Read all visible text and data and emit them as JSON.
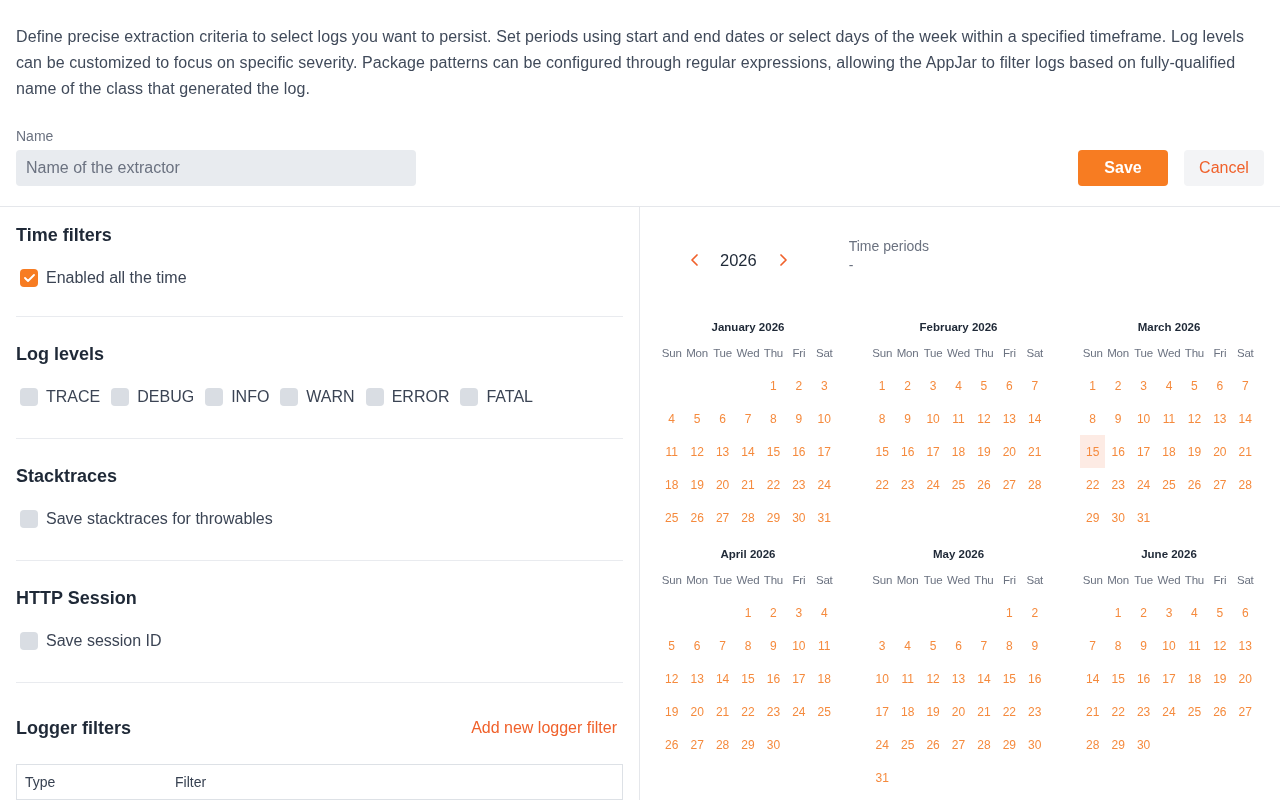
{
  "description": "Define precise extraction criteria to select logs you want to persist. Set periods using start and end dates or select days of the week within a specified timeframe. Log levels can be customized to focus on specific severity. Package patterns can be configured through regular expressions, allowing the AppJar to filter logs based on fully-qualified name of the class that generated the log.",
  "name_field": {
    "label": "Name",
    "placeholder": "Name of the extractor"
  },
  "buttons": [
    {
      "label": "Save",
      "kind": "primary"
    },
    {
      "label": "Cancel",
      "kind": "secondary"
    }
  ],
  "sections": [
    {
      "title": "Time filters",
      "options": [
        {
          "label": "Enabled all the time",
          "checked": true
        }
      ]
    },
    {
      "title": "Log levels",
      "options": [
        {
          "label": "TRACE",
          "checked": false
        },
        {
          "label": "DEBUG",
          "checked": false
        },
        {
          "label": "INFO",
          "checked": false
        },
        {
          "label": "WARN",
          "checked": false
        },
        {
          "label": "ERROR",
          "checked": false
        },
        {
          "label": "FATAL",
          "checked": false
        }
      ]
    },
    {
      "title": "Stacktraces",
      "options": [
        {
          "label": "Save stacktraces for throwables",
          "checked": false
        }
      ]
    },
    {
      "title": "HTTP Session",
      "options": [
        {
          "label": "Save session ID",
          "checked": false
        }
      ]
    }
  ],
  "logger_filters": {
    "title": "Logger filters",
    "add_link": "Add new logger filter",
    "table": {
      "columns": [
        "Type",
        "Filter"
      ]
    }
  },
  "calendar": {
    "year": "2026",
    "time_periods": {
      "label": "Time periods",
      "value": "-"
    },
    "months": [
      {
        "title": "January 2026",
        "weekdays": [
          "Sun",
          "Mon",
          "Tue",
          "Wed",
          "Thu",
          "Fri",
          "Sat"
        ],
        "weeks": [
          [
            {
              "day": "1",
              "today": false
            },
            {
              "day": "2",
              "today": false
            },
            {
              "day": "3",
              "today": false
            }
          ],
          [
            {
              "day": "4",
              "today": false
            },
            {
              "day": "5",
              "today": false
            },
            {
              "day": "6",
              "today": false
            },
            {
              "day": "7",
              "today": false
            },
            {
              "day": "8",
              "today": false
            },
            {
              "day": "9",
              "today": false
            },
            {
              "day": "10",
              "today": false
            }
          ],
          [
            {
              "day": "11",
              "today": false
            },
            {
              "day": "12",
              "today": false
            },
            {
              "day": "13",
              "today": false
            },
            {
              "day": "14",
              "today": false
            },
            {
              "day": "15",
              "today": false
            },
            {
              "day": "16",
              "today": false
            },
            {
              "day": "17",
              "today": false
            }
          ],
          [
            {
              "day": "18",
              "today": false
            },
            {
              "day": "19",
              "today": false
            },
            {
              "day": "20",
              "today": false
            },
            {
              "day": "21",
              "today": false
            },
            {
              "day": "22",
              "today": false
            },
            {
              "day": "23",
              "today": false
            },
            {
              "day": "24",
              "today": false
            }
          ],
          [
            {
              "day": "25",
              "today": false
            },
            {
              "day": "26",
              "today": false
            },
            {
              "day": "27",
              "today": false
            },
            {
              "day": "28",
              "today": false
            },
            {
              "day": "29",
              "today": false
            },
            {
              "day": "30",
              "today": false
            },
            {
              "day": "31",
              "today": false
            }
          ]
        ]
      },
      {
        "title": "February 2026",
        "weekdays": [
          "Sun",
          "Mon",
          "Tue",
          "Wed",
          "Thu",
          "Fri",
          "Sat"
        ],
        "weeks": [
          [
            {
              "day": "1",
              "today": false
            },
            {
              "day": "2",
              "today": false
            },
            {
              "day": "3",
              "today": false
            },
            {
              "day": "4",
              "today": false
            },
            {
              "day": "5",
              "today": false
            },
            {
              "day": "6",
              "today": false
            },
            {
              "day": "7",
              "today": false
            }
          ],
          [
            {
              "day": "8",
              "today": false
            },
            {
              "day": "9",
              "today": false
            },
            {
              "day": "10",
              "today": false
            },
            {
              "day": "11",
              "today": false
            },
            {
              "day": "12",
              "today": false
            },
            {
              "day": "13",
              "today": false
            },
            {
              "day": "14",
              "today": false
            }
          ],
          [
            {
              "day": "15",
              "today": false
            },
            {
              "day": "16",
              "today": false
            },
            {
              "day": "17",
              "today": false
            },
            {
              "day": "18",
              "today": false
            },
            {
              "day": "19",
              "today": false
            },
            {
              "day": "20",
              "today": false
            },
            {
              "day": "21",
              "today": false
            }
          ],
          [
            {
              "day": "22",
              "today": false
            },
            {
              "day": "23",
              "today": false
            },
            {
              "day": "24",
              "today": false
            },
            {
              "day": "25",
              "today": false
            },
            {
              "day": "26",
              "today": false
            },
            {
              "day": "27",
              "today": false
            },
            {
              "day": "28",
              "today": false
            }
          ]
        ]
      },
      {
        "title": "March 2026",
        "weekdays": [
          "Sun",
          "Mon",
          "Tue",
          "Wed",
          "Thu",
          "Fri",
          "Sat"
        ],
        "weeks": [
          [
            {
              "day": "1",
              "today": false
            },
            {
              "day": "2",
              "today": false
            },
            {
              "day": "3",
              "today": false
            },
            {
              "day": "4",
              "today": false
            },
            {
              "day": "5",
              "today": false
            },
            {
              "day": "6",
              "today": false
            },
            {
              "day": "7",
              "today": false
            }
          ],
          [
            {
              "day": "8",
              "today": false
            },
            {
              "day": "9",
              "today": false
            },
            {
              "day": "10",
              "today": false
            },
            {
              "day": "11",
              "today": false
            },
            {
              "day": "12",
              "today": false
            },
            {
              "day": "13",
              "today": false
            },
            {
              "day": "14",
              "today": false
            }
          ],
          [
            {
              "day": "15",
              "today": true
            },
            {
              "day": "16",
              "today": false
            },
            {
              "day": "17",
              "today": false
            },
            {
              "day": "18",
              "today": false
            },
            {
              "day": "19",
              "today": false
            },
            {
              "day": "20",
              "today": false
            },
            {
              "day": "21",
              "today": false
            }
          ],
          [
            {
              "day": "22",
              "today": false
            },
            {
              "day": "23",
              "today": false
            },
            {
              "day": "24",
              "today": false
            },
            {
              "day": "25",
              "today": false
            },
            {
              "day": "26",
              "today": false
            },
            {
              "day": "27",
              "today": false
            },
            {
              "day": "28",
              "today": false
            }
          ],
          [
            {
              "day": "29",
              "today": false
            },
            {
              "day": "30",
              "today": false
            },
            {
              "day": "31",
              "today": false
            }
          ]
        ]
      },
      {
        "title": "April 2026",
        "weekdays": [
          "Sun",
          "Mon",
          "Tue",
          "Wed",
          "Thu",
          "Fri",
          "Sat"
        ],
        "weeks": [
          [
            {
              "day": "1",
              "today": false
            },
            {
              "day": "2",
              "today": false
            },
            {
              "day": "3",
              "today": false
            },
            {
              "day": "4",
              "today": false
            }
          ],
          [
            {
              "day": "5",
              "today": false
            },
            {
              "day": "6",
              "today": false
            },
            {
              "day": "7",
              "today": false
            },
            {
              "day": "8",
              "today": false
            },
            {
              "day": "9",
              "today": false
            },
            {
              "day": "10",
              "today": false
            },
            {
              "day": "11",
              "today": false
            }
          ],
          [
            {
              "day": "12",
              "today": false
            },
            {
              "day": "13",
              "today": false
            },
            {
              "day": "14",
              "today": false
            },
            {
              "day": "15",
              "today": false
            },
            {
              "day": "16",
              "today": false
            },
            {
              "day": "17",
              "today": false
            },
            {
              "day": "18",
              "today": false
            }
          ],
          [
            {
              "day": "19",
              "today": false
            },
            {
              "day": "20",
              "today": false
            },
            {
              "day": "21",
              "today": false
            },
            {
              "day": "22",
              "today": false
            },
            {
              "day": "23",
              "today": false
            },
            {
              "day": "24",
              "today": false
            },
            {
              "day": "25",
              "today": false
            }
          ],
          [
            {
              "day": "26",
              "today": false
            },
            {
              "day": "27",
              "today": false
            },
            {
              "day": "28",
              "today": false
            },
            {
              "day": "29",
              "today": false
            },
            {
              "day": "30",
              "today": false
            }
          ]
        ]
      },
      {
        "title": "May 2026",
        "weekdays": [
          "Sun",
          "Mon",
          "Tue",
          "Wed",
          "Thu",
          "Fri",
          "Sat"
        ],
        "weeks": [
          [
            {
              "day": "1",
              "today": false
            },
            {
              "day": "2",
              "today": false
            }
          ],
          [
            {
              "day": "3",
              "today": false
            },
            {
              "day": "4",
              "today": false
            },
            {
              "day": "5",
              "today": false
            },
            {
              "day": "6",
              "today": false
            },
            {
              "day": "7",
              "today": false
            },
            {
              "day": "8",
              "today": false
            },
            {
              "day": "9",
              "today": false
            }
          ],
          [
            {
              "day": "10",
              "today": false
            },
            {
              "day": "11",
              "today": false
            },
            {
              "day": "12",
              "today": false
            },
            {
              "day": "13",
              "today": false
            },
            {
              "day": "14",
              "today": false
            },
            {
              "day": "15",
              "today": false
            },
            {
              "day": "16",
              "today": false
            }
          ],
          [
            {
              "day": "17",
              "today": false
            },
            {
              "day": "18",
              "today": false
            },
            {
              "day": "19",
              "today": false
            },
            {
              "day": "20",
              "today": false
            },
            {
              "day": "21",
              "today": false
            },
            {
              "day": "22",
              "today": false
            },
            {
              "day": "23",
              "today": false
            }
          ],
          [
            {
              "day": "24",
              "today": false
            },
            {
              "day": "25",
              "today": false
            },
            {
              "day": "26",
              "today": false
            },
            {
              "day": "27",
              "today": false
            },
            {
              "day": "28",
              "today": false
            },
            {
              "day": "29",
              "today": false
            },
            {
              "day": "30",
              "today": false
            }
          ],
          [
            {
              "day": "31",
              "today": false
            }
          ]
        ]
      },
      {
        "title": "June 2026",
        "weekdays": [
          "Sun",
          "Mon",
          "Tue",
          "Wed",
          "Thu",
          "Fri",
          "Sat"
        ],
        "weeks": [
          [
            {
              "day": "1",
              "today": false
            },
            {
              "day": "2",
              "today": false
            },
            {
              "day": "3",
              "today": false
            },
            {
              "day": "4",
              "today": false
            },
            {
              "day": "5",
              "today": false
            },
            {
              "day": "6",
              "today": false
            }
          ],
          [
            {
              "day": "7",
              "today": false
            },
            {
              "day": "8",
              "today": false
            },
            {
              "day": "9",
              "today": false
            },
            {
              "day": "10",
              "today": false
            },
            {
              "day": "11",
              "today": false
            },
            {
              "day": "12",
              "today": false
            },
            {
              "day": "13",
              "today": false
            }
          ],
          [
            {
              "day": "14",
              "today": false
            },
            {
              "day": "15",
              "today": false
            },
            {
              "day": "16",
              "today": false
            },
            {
              "day": "17",
              "today": false
            },
            {
              "day": "18",
              "today": false
            },
            {
              "day": "19",
              "today": false
            },
            {
              "day": "20",
              "today": false
            }
          ],
          [
            {
              "day": "21",
              "today": false
            },
            {
              "day": "22",
              "today": false
            },
            {
              "day": "23",
              "today": false
            },
            {
              "day": "24",
              "today": false
            },
            {
              "day": "25",
              "today": false
            },
            {
              "day": "26",
              "today": false
            },
            {
              "day": "27",
              "today": false
            }
          ],
          [
            {
              "day": "28",
              "today": false
            },
            {
              "day": "29",
              "today": false
            },
            {
              "day": "30",
              "today": false
            }
          ]
        ]
      }
    ]
  }
}
